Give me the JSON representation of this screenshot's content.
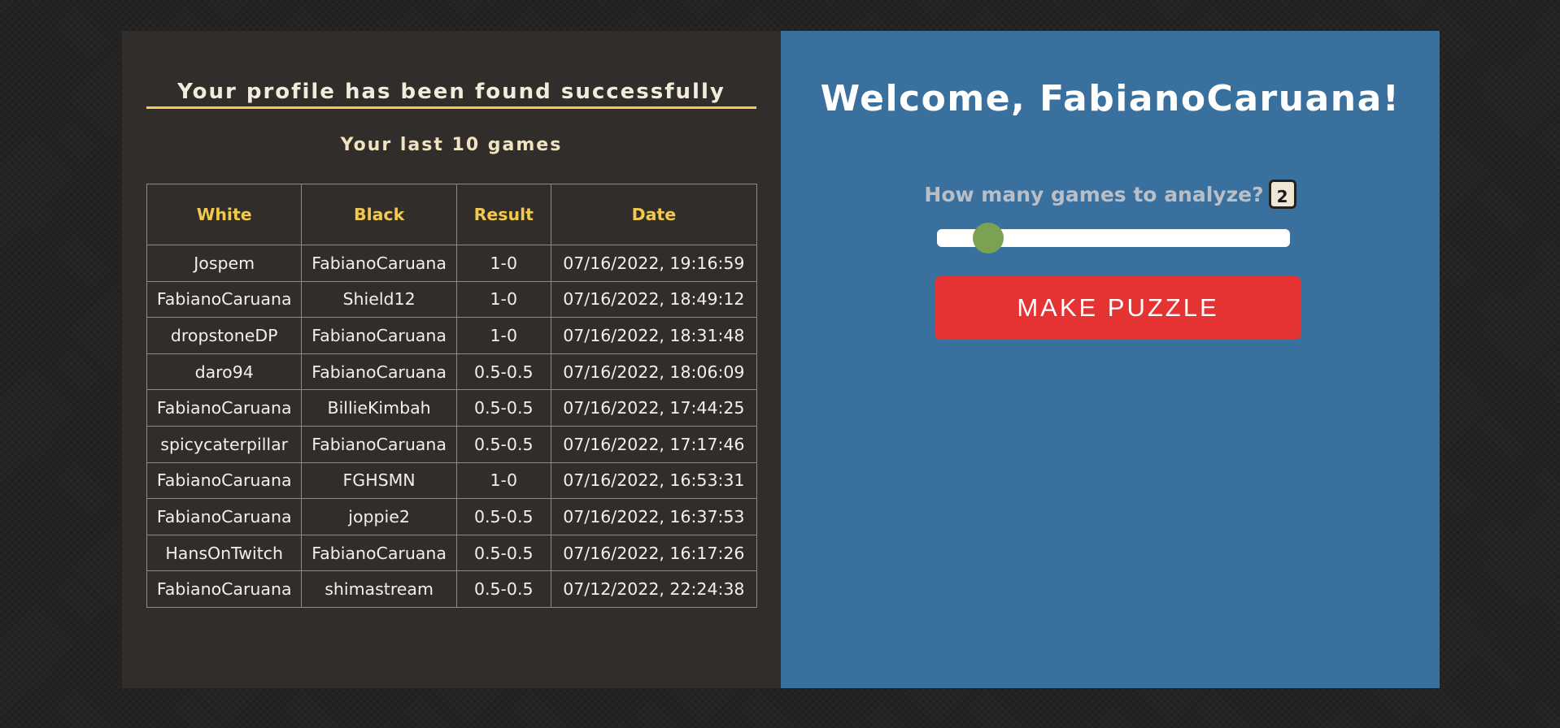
{
  "profile": {
    "found_heading": "Your profile has been found successfully",
    "games_subtitle": "Your last 10 games"
  },
  "games_table": {
    "headers": [
      "White",
      "Black",
      "Result",
      "Date"
    ],
    "rows": [
      [
        "Jospem",
        "FabianoCaruana",
        "1-0",
        "07/16/2022, 19:16:59"
      ],
      [
        "FabianoCaruana",
        "Shield12",
        "1-0",
        "07/16/2022, 18:49:12"
      ],
      [
        "dropstoneDP",
        "FabianoCaruana",
        "1-0",
        "07/16/2022, 18:31:48"
      ],
      [
        "daro94",
        "FabianoCaruana",
        "0.5-0.5",
        "07/16/2022, 18:06:09"
      ],
      [
        "FabianoCaruana",
        "BillieKimbah",
        "0.5-0.5",
        "07/16/2022, 17:44:25"
      ],
      [
        "spicycaterpillar",
        "FabianoCaruana",
        "0.5-0.5",
        "07/16/2022, 17:17:46"
      ],
      [
        "FabianoCaruana",
        "FGHSMN",
        "1-0",
        "07/16/2022, 16:53:31"
      ],
      [
        "FabianoCaruana",
        "joppie2",
        "0.5-0.5",
        "07/16/2022, 16:37:53"
      ],
      [
        "HansOnTwitch",
        "FabianoCaruana",
        "0.5-0.5",
        "07/16/2022, 16:17:26"
      ],
      [
        "FabianoCaruana",
        "shimastream",
        "0.5-0.5",
        "07/12/2022, 22:24:38"
      ]
    ]
  },
  "analyzer": {
    "welcome": "Welcome, FabianoCaruana!",
    "question": "How many games to analyze?",
    "count": "2",
    "slider": {
      "min": 1,
      "max": 10,
      "value": 2
    },
    "make_puzzle_label": "MAKE PUZZLE"
  },
  "colors": {
    "page_bg": "#232323",
    "left_panel_bg": "#312d2b",
    "right_panel_bg": "#3a709d",
    "accent_yellow": "#f2c94c",
    "button_red": "#e53334",
    "slider_thumb": "#7ba253"
  }
}
